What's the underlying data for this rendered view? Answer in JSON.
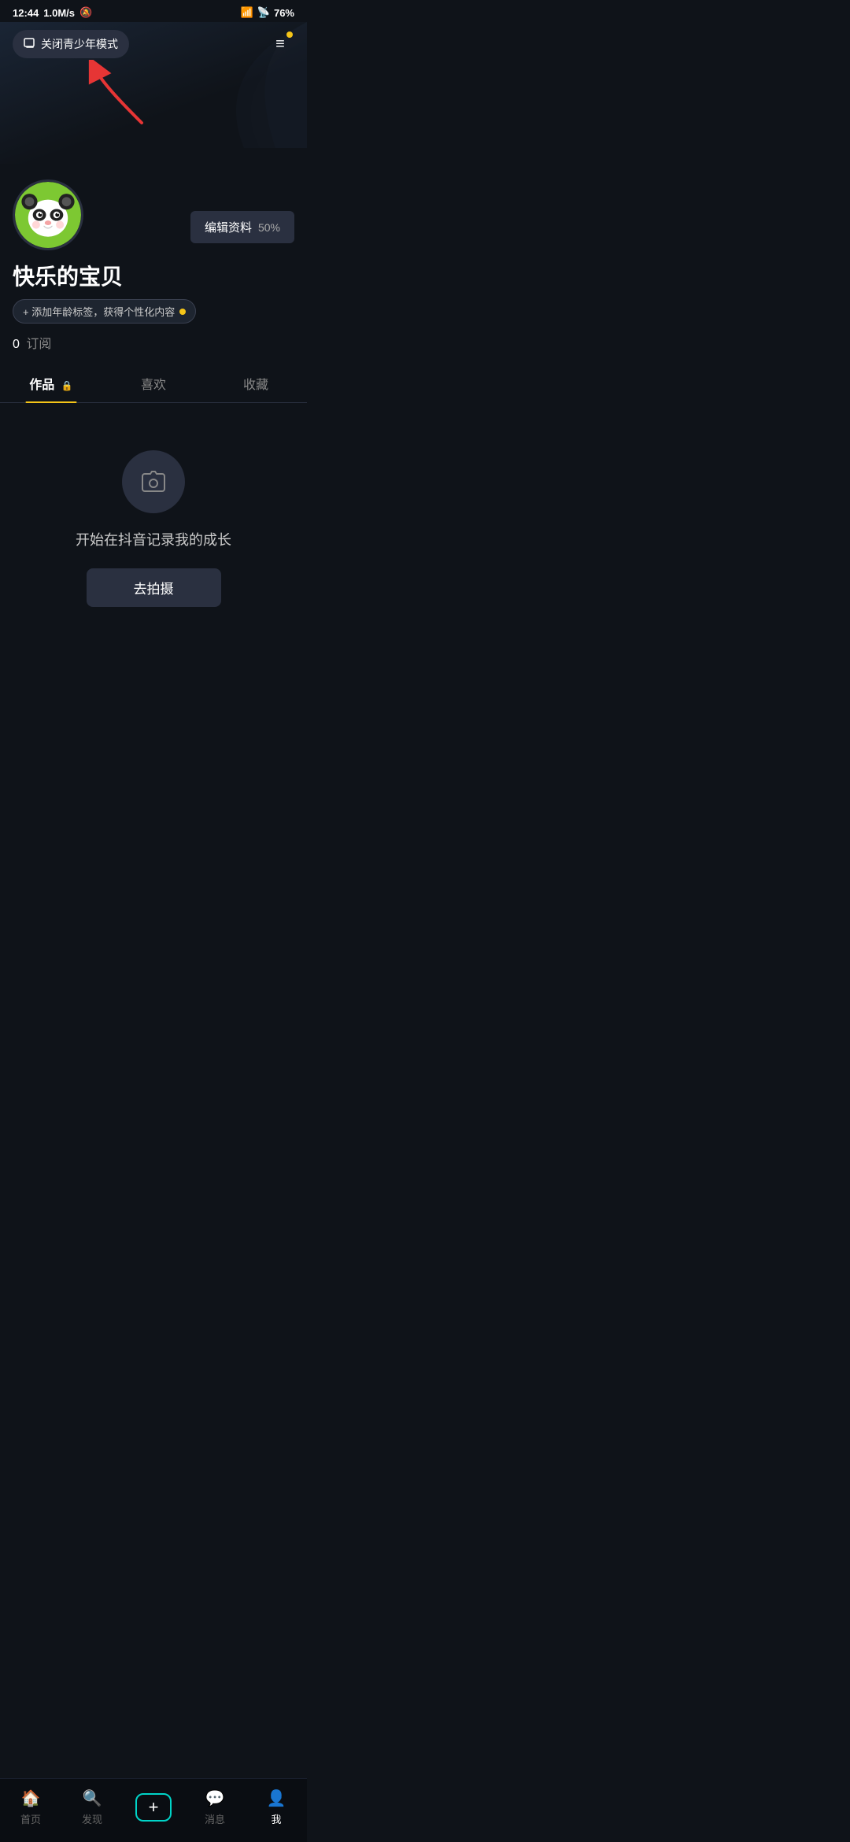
{
  "statusBar": {
    "time": "12:44",
    "network": "1.0M/s",
    "battery": "76%"
  },
  "topNav": {
    "youthModeLabel": "关闭青少年模式",
    "menuIcon": "≡"
  },
  "profile": {
    "username": "快乐的宝贝",
    "editProfileLabel": "编辑资料",
    "editProfilePercent": "50%",
    "ageTagLabel": "+ 添加年龄标签，获得个性化内容",
    "subscribeCount": "0",
    "subscribeLabel": "订阅"
  },
  "tabs": [
    {
      "label": "作品",
      "active": true,
      "hasLock": true
    },
    {
      "label": "喜欢",
      "active": false,
      "hasLock": false
    },
    {
      "label": "收藏",
      "active": false,
      "hasLock": false
    }
  ],
  "emptyState": {
    "text": "开始在抖音记录我的成长",
    "buttonLabel": "去拍摄"
  },
  "bottomNav": [
    {
      "label": "首页",
      "active": false
    },
    {
      "label": "发现",
      "active": false
    },
    {
      "label": "+",
      "isPlus": true
    },
    {
      "label": "消息",
      "active": false
    },
    {
      "label": "我",
      "active": true
    }
  ]
}
